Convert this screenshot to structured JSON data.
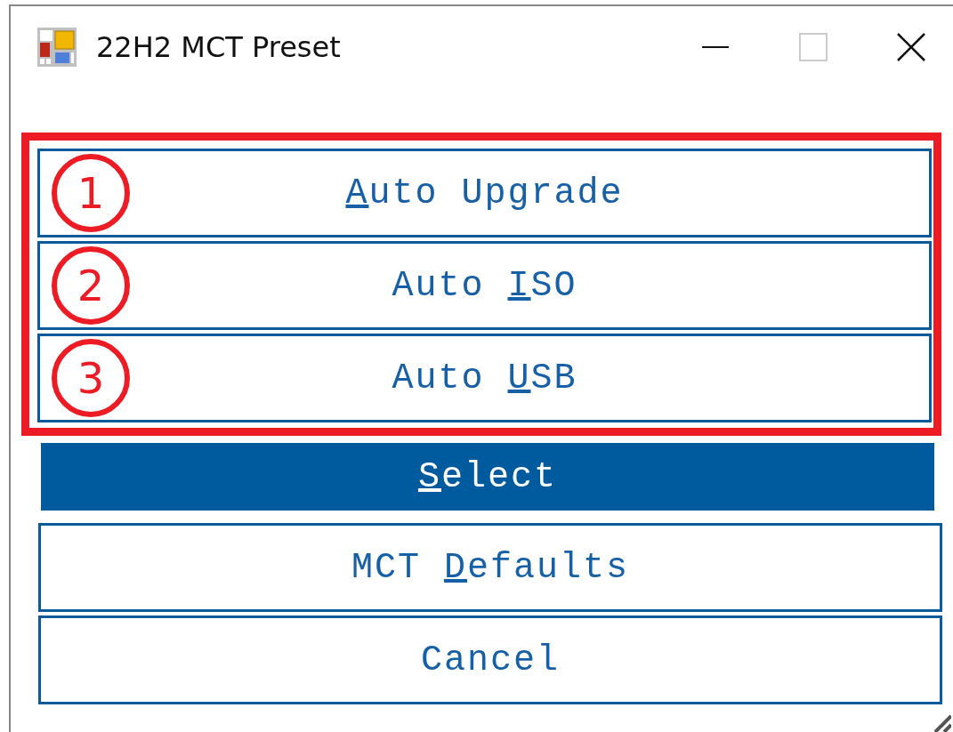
{
  "window": {
    "title": "22H2 MCT Preset"
  },
  "options": [
    {
      "number": "1",
      "label": {
        "key": "A",
        "after": "uto Upgrade"
      }
    },
    {
      "number": "2",
      "label": {
        "before": "Auto ",
        "key": "I",
        "after": "SO"
      }
    },
    {
      "number": "3",
      "label": {
        "before": "Auto ",
        "key": "U",
        "after": "SB"
      }
    }
  ],
  "buttons": [
    {
      "kind": "primary",
      "label": {
        "key": "S",
        "after": "elect"
      }
    },
    {
      "kind": "normal",
      "label": {
        "before": "MCT ",
        "key": "D",
        "after": "efaults"
      }
    },
    {
      "kind": "normal",
      "label": {
        "before": "Cancel"
      }
    }
  ]
}
